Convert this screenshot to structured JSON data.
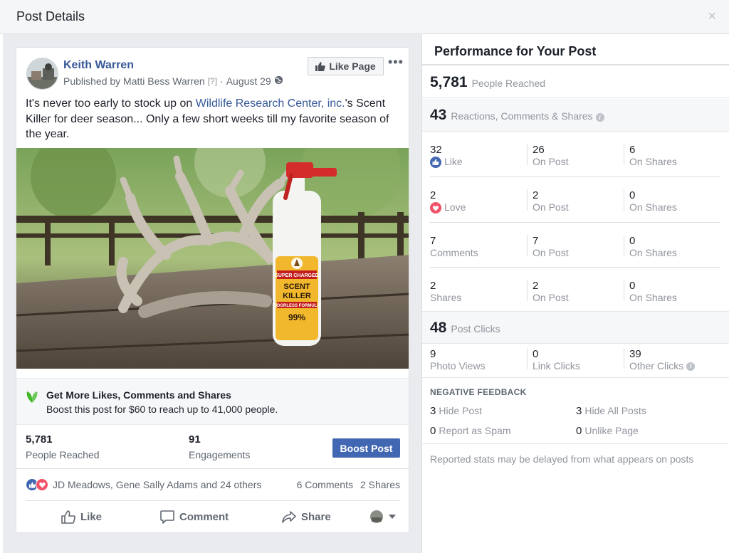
{
  "dialog": {
    "title": "Post Details",
    "close_glyph": "×"
  },
  "post": {
    "author": "Keith Warren",
    "published_by": "Published by Matti Bess Warren",
    "help_mark": "[?]",
    "separator": "·",
    "date": "August 29",
    "privacy_icon": "globe-icon",
    "like_page_label": "Like Page",
    "more_glyph": "•••",
    "text_before": "It's never too early to stock up on ",
    "text_link": "Wildlife Research Center, inc.",
    "text_after": "'s Scent Killer for deer season... Only a few short weeks till my favorite season of the year.",
    "product_label_line1": "SUPER CHARGED",
    "product_label_line2": "SCENT",
    "product_label_line3": "KILLER",
    "product_label_line4": "ODORLESS FORMULA",
    "product_label_line5": "99%",
    "boost": {
      "title": "Get More Likes, Comments and Shares",
      "subtitle": "Boost this post for $60 to reach up to 41,000 people."
    },
    "stats": {
      "reached_value": "5,781",
      "reached_label": "People Reached",
      "engagements_value": "91",
      "engagements_label": "Engagements",
      "boost_button": "Boost Post"
    },
    "reactions_text": "JD Meadows, Gene Sally Adams and 24 others",
    "comments_count": "6 Comments",
    "shares_count": "2 Shares",
    "actions": {
      "like": "Like",
      "comment": "Comment",
      "share": "Share"
    }
  },
  "performance": {
    "title": "Performance for Your Post",
    "reached_value": "5,781",
    "reached_label": "People Reached",
    "rcs_value": "43",
    "rcs_label": "Reactions, Comments & Shares",
    "rows": [
      {
        "total": "32",
        "label": "Like",
        "icon": "like-reaction-icon",
        "on_post": "26",
        "on_shares": "6"
      },
      {
        "total": "2",
        "label": "Love",
        "icon": "love-reaction-icon",
        "on_post": "2",
        "on_shares": "0"
      },
      {
        "total": "7",
        "label": "Comments",
        "icon": "",
        "on_post": "7",
        "on_shares": "0"
      },
      {
        "total": "2",
        "label": "Shares",
        "icon": "",
        "on_post": "2",
        "on_shares": "0"
      }
    ],
    "on_post_label": "On Post",
    "on_shares_label": "On Shares",
    "clicks_value": "48",
    "clicks_label": "Post Clicks",
    "click_breakdown": [
      {
        "value": "9",
        "label": "Photo Views"
      },
      {
        "value": "0",
        "label": "Link Clicks"
      },
      {
        "value": "39",
        "label": "Other Clicks"
      }
    ],
    "negative": {
      "title": "NEGATIVE FEEDBACK",
      "hide_post_value": "3",
      "hide_post_label": "Hide Post",
      "hide_all_value": "3",
      "hide_all_label": "Hide All Posts",
      "spam_value": "0",
      "spam_label": "Report as Spam",
      "unlike_value": "0",
      "unlike_label": "Unlike Page"
    },
    "footnote": "Reported stats may be delayed from what appears on posts"
  },
  "colors": {
    "link": "#385898",
    "brand": "#4267b2",
    "love": "#f25268",
    "leaf": "#42b72a"
  }
}
